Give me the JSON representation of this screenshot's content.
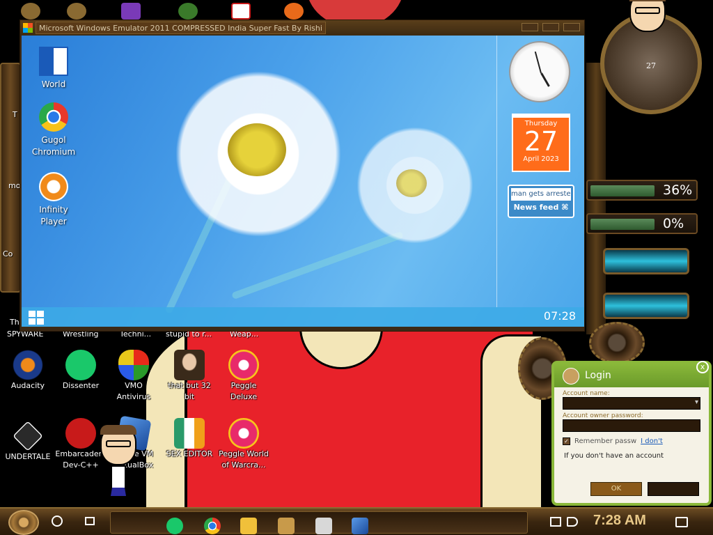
{
  "emulator": {
    "title": "Microsoft Windows Emulator 2011 COMPRESSED India Super Fast By Rishi",
    "desktop_icons": [
      {
        "label": "World",
        "icon": "word-icon"
      },
      {
        "label": "Gugol Chromium",
        "icon": "chrome-icon"
      },
      {
        "label": "Infinity Player",
        "icon": "media-player-icon"
      }
    ],
    "calendar": {
      "day": "Thursday",
      "date": "27",
      "month_year": "April 2023"
    },
    "news": {
      "headline": "man gets arreste",
      "label": "News feed"
    },
    "taskbar_time": "07:28"
  },
  "host_desktop": {
    "partial_labels": [
      "T",
      "mo",
      "Th",
      "Co",
      "SPYWARE",
      "Wrestling",
      "Techni...",
      "stupid to r...",
      "Weap..."
    ],
    "icons": [
      {
        "label": "Audacity",
        "icon": "audacity-icon"
      },
      {
        "label": "Dissenter",
        "icon": "dissenter-icon"
      },
      {
        "label": "VMO Antivirus",
        "icon": "shield-icon"
      },
      {
        "label": "that but 32 bit",
        "icon": "portrait-icon"
      },
      {
        "label": "Peggle Deluxe",
        "icon": "peggle-icon"
      },
      {
        "label": "UNDERTALE",
        "icon": "unity-icon"
      },
      {
        "label": "Embarcadero Dev-C++",
        "icon": "devcpp-icon"
      },
      {
        "label": "Oracle VM VirtualBox",
        "icon": "virtualbox-icon"
      },
      {
        "label": "SEX EDITOR",
        "icon": "hxd-icon"
      },
      {
        "label": "Peggle World of Warcra...",
        "icon": "peggle-icon"
      }
    ]
  },
  "widgets": {
    "clock_number": "27",
    "cpu_meter": "36%",
    "ram_meter": "0%"
  },
  "login": {
    "title": "Login",
    "account_label": "Account name:",
    "password_label": "Account owner password:",
    "remember_label": "Remember passw",
    "forgot_link": "I don't",
    "message": "If you don't have an account",
    "ok_label": "OK"
  },
  "taskbar": {
    "time": "7:28 AM",
    "pinned": [
      "dissenter-icon",
      "chrome-icon",
      "folder-icon",
      "box-icon",
      "paint-icon",
      "virtualbox-icon"
    ]
  }
}
